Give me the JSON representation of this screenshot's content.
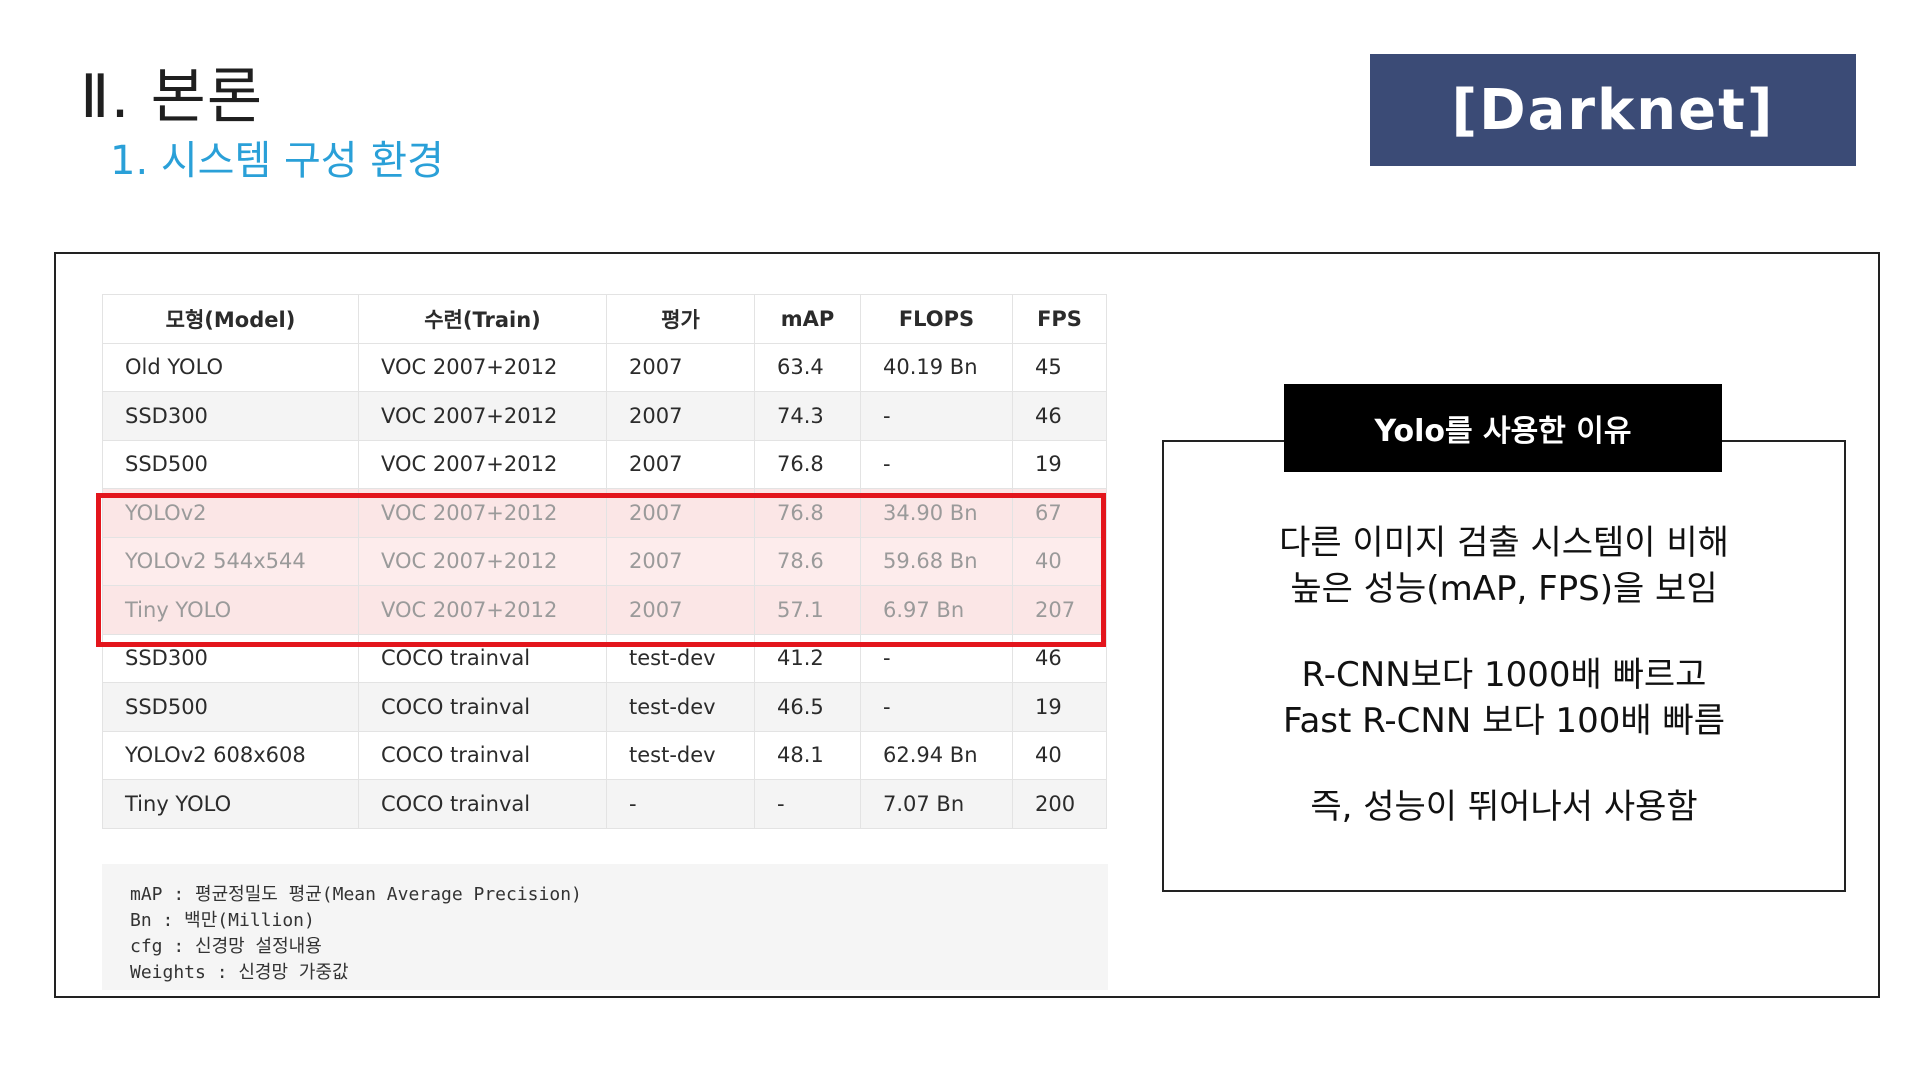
{
  "header": {
    "section": "Ⅱ. 본론",
    "subsection": "1. 시스템 구성 환경",
    "badge": "[Darknet]"
  },
  "table": {
    "columns": [
      "모형(Model)",
      "수련(Train)",
      "평가",
      "mAP",
      "FLOPS",
      "FPS"
    ],
    "rows": [
      {
        "cells": [
          "Old YOLO",
          "VOC 2007+2012",
          "2007",
          "63.4",
          "40.19 Bn",
          "45"
        ],
        "highlight": false
      },
      {
        "cells": [
          "SSD300",
          "VOC 2007+2012",
          "2007",
          "74.3",
          "-",
          "46"
        ],
        "highlight": false
      },
      {
        "cells": [
          "SSD500",
          "VOC 2007+2012",
          "2007",
          "76.8",
          "-",
          "19"
        ],
        "highlight": false
      },
      {
        "cells": [
          "YOLOv2",
          "VOC 2007+2012",
          "2007",
          "76.8",
          "34.90 Bn",
          "67"
        ],
        "highlight": true
      },
      {
        "cells": [
          "YOLOv2 544x544",
          "VOC 2007+2012",
          "2007",
          "78.6",
          "59.68 Bn",
          "40"
        ],
        "highlight": true
      },
      {
        "cells": [
          "Tiny YOLO",
          "VOC 2007+2012",
          "2007",
          "57.1",
          "6.97 Bn",
          "207"
        ],
        "highlight": true
      },
      {
        "cells": [
          "SSD300",
          "COCO trainval",
          "test-dev",
          "41.2",
          "-",
          "46"
        ],
        "highlight": false
      },
      {
        "cells": [
          "SSD500",
          "COCO trainval",
          "test-dev",
          "46.5",
          "-",
          "19"
        ],
        "highlight": false
      },
      {
        "cells": [
          "YOLOv2 608x608",
          "COCO trainval",
          "test-dev",
          "48.1",
          "62.94 Bn",
          "40"
        ],
        "highlight": false
      },
      {
        "cells": [
          "Tiny YOLO",
          "COCO trainval",
          "-",
          "-",
          "7.07 Bn",
          "200"
        ],
        "highlight": false
      }
    ]
  },
  "notes": [
    "mAP : 평균정밀도 평균(Mean Average Precision)",
    "Bn : 백만(Million)",
    "cfg : 신경망 설정내용",
    "Weights : 신경망 가중값"
  ],
  "reason": {
    "title": "Yolo를 사용한 이유",
    "line1": "다른 이미지 검출 시스템이 비해",
    "line2": "높은 성능(mAP, FPS)을 보임",
    "line3": "R-CNN보다 1000배 빠르고",
    "line4": "Fast R-CNN 보다 100배 빠름",
    "line5": "즉, 성능이 뛰어나서 사용함"
  },
  "colors": {
    "badge_bg": "#3b4b76",
    "subtitle": "#2aa0d8",
    "highlight_border": "#e3151c"
  }
}
